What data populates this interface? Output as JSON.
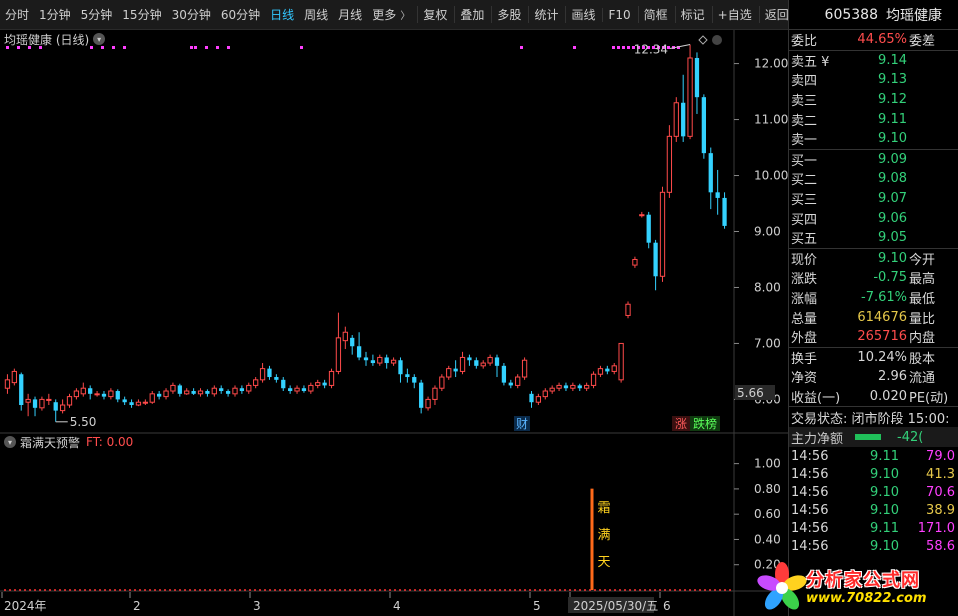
{
  "toolbar": {
    "items": [
      {
        "label": "分时",
        "active": false
      },
      {
        "label": "1分钟",
        "active": false
      },
      {
        "label": "5分钟",
        "active": false
      },
      {
        "label": "15分钟",
        "active": false
      },
      {
        "label": "30分钟",
        "active": false
      },
      {
        "label": "60分钟",
        "active": false
      },
      {
        "label": "日线",
        "active": true
      },
      {
        "label": "周线",
        "active": false
      },
      {
        "label": "月线",
        "active": false
      }
    ],
    "more": "更多",
    "right_items": [
      "复权",
      "叠加",
      "多股",
      "统计",
      "画线",
      "F10",
      "简框",
      "标记",
      "+自选",
      "返回"
    ]
  },
  "chart": {
    "title": "均瑶健康 (日线)",
    "high_label": "12.34",
    "low_label": "5.50",
    "price_tag": "5.66",
    "marker_cai": "财",
    "marker_zhang": "涨",
    "marker_die": "跌榜",
    "y_ticks": [
      "12.00",
      "11.00",
      "10.00",
      "9.00",
      "8.00",
      "7.00",
      "6.00"
    ],
    "date_labels": [
      "2024年",
      "2",
      "3",
      "4",
      "5",
      "2025/05/30/五",
      "6"
    ]
  },
  "indicator": {
    "name": "霜满天预警",
    "ft": "FT: 0.00",
    "signal_chars": [
      "霜",
      "满",
      "天"
    ],
    "y_ticks": [
      "1.00",
      "0.80",
      "0.60",
      "0.40",
      "0.20"
    ]
  },
  "chart_data": {
    "type": "candlestick",
    "title": "均瑶健康 (日线)",
    "ylim": [
      5.4,
      12.6
    ],
    "candles": [
      [
        6.2,
        6.35,
        6.45,
        6.1
      ],
      [
        6.3,
        6.5,
        6.55,
        6.25
      ],
      [
        6.45,
        5.9,
        6.48,
        5.8
      ],
      [
        5.95,
        6.0,
        6.1,
        5.7
      ],
      [
        6.0,
        5.85,
        6.05,
        5.7
      ],
      [
        5.85,
        6.0,
        6.05,
        5.8
      ],
      [
        6.0,
        6.0,
        6.1,
        5.9
      ],
      [
        5.95,
        5.8,
        6.0,
        5.6
      ],
      [
        5.8,
        5.9,
        6.0,
        5.75
      ],
      [
        5.9,
        6.05,
        6.1,
        5.85
      ],
      [
        6.05,
        6.15,
        6.2,
        6.0
      ],
      [
        6.1,
        6.2,
        6.3,
        6.05
      ],
      [
        6.2,
        6.1,
        6.25,
        6.0
      ],
      [
        6.1,
        6.1,
        6.15,
        6.05
      ],
      [
        6.1,
        6.05,
        6.15,
        6.0
      ],
      [
        6.05,
        6.15,
        6.2,
        6.0
      ],
      [
        6.15,
        6.0,
        6.18,
        5.95
      ],
      [
        6.0,
        5.95,
        6.05,
        5.9
      ],
      [
        5.95,
        5.9,
        6.0,
        5.85
      ],
      [
        5.9,
        5.95,
        6.0,
        5.88
      ],
      [
        5.95,
        5.95,
        6.0,
        5.9
      ],
      [
        5.95,
        6.1,
        6.15,
        5.92
      ],
      [
        6.1,
        6.05,
        6.15,
        6.0
      ],
      [
        6.05,
        6.15,
        6.2,
        6.0
      ],
      [
        6.15,
        6.25,
        6.3,
        6.1
      ],
      [
        6.25,
        6.1,
        6.28,
        6.05
      ],
      [
        6.1,
        6.15,
        6.2,
        6.08
      ],
      [
        6.15,
        6.1,
        6.2,
        6.08
      ],
      [
        6.1,
        6.15,
        6.2,
        6.05
      ],
      [
        6.15,
        6.1,
        6.18,
        6.05
      ],
      [
        6.1,
        6.2,
        6.25,
        6.05
      ],
      [
        6.2,
        6.15,
        6.25,
        6.1
      ],
      [
        6.15,
        6.1,
        6.18,
        6.05
      ],
      [
        6.1,
        6.2,
        6.25,
        6.05
      ],
      [
        6.2,
        6.15,
        6.25,
        6.1
      ],
      [
        6.15,
        6.25,
        6.3,
        6.1
      ],
      [
        6.25,
        6.35,
        6.4,
        6.2
      ],
      [
        6.35,
        6.55,
        6.65,
        6.3
      ],
      [
        6.55,
        6.4,
        6.6,
        6.35
      ],
      [
        6.4,
        6.35,
        6.45,
        6.3
      ],
      [
        6.35,
        6.2,
        6.4,
        6.15
      ],
      [
        6.2,
        6.15,
        6.25,
        6.1
      ],
      [
        6.15,
        6.2,
        6.25,
        6.1
      ],
      [
        6.2,
        6.15,
        6.25,
        6.12
      ],
      [
        6.15,
        6.25,
        6.3,
        6.1
      ],
      [
        6.25,
        6.3,
        6.35,
        6.2
      ],
      [
        6.3,
        6.25,
        6.35,
        6.2
      ],
      [
        6.25,
        6.5,
        6.55,
        6.2
      ],
      [
        6.5,
        7.1,
        7.55,
        6.45
      ],
      [
        7.05,
        7.2,
        7.3,
        6.9
      ],
      [
        7.1,
        6.95,
        7.15,
        6.8
      ],
      [
        6.95,
        6.75,
        7.2,
        6.7
      ],
      [
        6.75,
        6.7,
        6.85,
        6.6
      ],
      [
        6.7,
        6.65,
        6.8,
        6.6
      ],
      [
        6.65,
        6.75,
        6.8,
        6.6
      ],
      [
        6.75,
        6.65,
        6.8,
        6.55
      ],
      [
        6.65,
        6.7,
        6.75,
        6.6
      ],
      [
        6.7,
        6.45,
        6.75,
        6.3
      ],
      [
        6.45,
        6.4,
        6.55,
        6.3
      ],
      [
        6.4,
        6.3,
        6.45,
        6.2
      ],
      [
        6.3,
        5.85,
        6.35,
        5.75
      ],
      [
        5.85,
        6.0,
        6.05,
        5.8
      ],
      [
        6.0,
        6.2,
        6.25,
        5.9
      ],
      [
        6.2,
        6.4,
        6.45,
        6.15
      ],
      [
        6.4,
        6.55,
        6.6,
        6.35
      ],
      [
        6.55,
        6.5,
        6.7,
        6.4
      ],
      [
        6.5,
        6.75,
        6.85,
        6.45
      ],
      [
        6.75,
        6.7,
        6.8,
        6.6
      ],
      [
        6.7,
        6.6,
        6.75,
        6.55
      ],
      [
        6.6,
        6.65,
        6.7,
        6.55
      ],
      [
        6.65,
        6.75,
        6.8,
        6.6
      ],
      [
        6.75,
        6.6,
        6.8,
        6.4
      ],
      [
        6.6,
        6.3,
        6.65,
        6.25
      ],
      [
        6.3,
        6.25,
        6.35,
        6.2
      ],
      [
        6.25,
        6.4,
        6.45,
        6.2
      ],
      [
        6.4,
        6.7,
        6.75,
        6.35
      ],
      [
        6.1,
        5.95,
        6.15,
        5.85
      ],
      [
        5.95,
        6.05,
        6.1,
        5.9
      ],
      [
        6.05,
        6.15,
        6.2,
        6.0
      ],
      [
        6.15,
        6.2,
        6.25,
        6.1
      ],
      [
        6.2,
        6.25,
        6.3,
        6.15
      ],
      [
        6.25,
        6.2,
        6.3,
        6.15
      ],
      [
        6.2,
        6.25,
        6.3,
        6.15
      ],
      [
        6.25,
        6.2,
        6.28,
        6.15
      ],
      [
        6.2,
        6.25,
        6.3,
        6.15
      ],
      [
        6.25,
        6.45,
        6.5,
        6.2
      ],
      [
        6.45,
        6.55,
        6.6,
        6.4
      ],
      [
        6.55,
        6.5,
        6.6,
        6.45
      ],
      [
        6.5,
        6.6,
        6.65,
        6.45
      ],
      [
        6.35,
        7.0,
        7.0,
        6.3
      ],
      [
        7.5,
        7.7,
        7.75,
        7.45
      ],
      [
        8.4,
        8.5,
        8.55,
        8.35
      ],
      [
        9.3,
        9.3,
        9.35,
        9.25
      ],
      [
        9.3,
        8.8,
        9.35,
        8.7
      ],
      [
        8.8,
        8.2,
        8.85,
        7.95
      ],
      [
        8.2,
        9.7,
        9.8,
        8.1
      ],
      [
        9.7,
        10.7,
        10.9,
        9.6
      ],
      [
        10.7,
        11.3,
        11.4,
        10.6
      ],
      [
        11.3,
        10.7,
        11.8,
        10.6
      ],
      [
        10.7,
        12.1,
        12.34,
        10.65
      ],
      [
        12.1,
        11.4,
        12.2,
        11.1
      ],
      [
        11.4,
        10.4,
        11.45,
        10.3
      ],
      [
        10.4,
        9.7,
        10.5,
        9.4
      ],
      [
        9.7,
        9.6,
        10.1,
        9.3
      ],
      [
        9.6,
        9.1,
        9.7,
        9.05
      ]
    ],
    "indicator": {
      "name": "霜满天预警",
      "ylim": [
        0,
        1.1
      ],
      "signals": [
        {
          "date": "2025/05/30/五",
          "value": 1.0
        }
      ]
    }
  },
  "panel": {
    "code": "605388",
    "name": "均瑶健康",
    "weibi": {
      "label": "委比",
      "value": "44.65%",
      "label2": "委差"
    },
    "asks": [
      {
        "label": "卖五 ¥",
        "price": "9.14"
      },
      {
        "label": "卖四",
        "price": "9.13"
      },
      {
        "label": "卖三",
        "price": "9.12"
      },
      {
        "label": "卖二",
        "price": "9.11"
      },
      {
        "label": "卖一",
        "price": "9.10"
      }
    ],
    "bids": [
      {
        "label": "买一",
        "price": "9.09"
      },
      {
        "label": "买二",
        "price": "9.08"
      },
      {
        "label": "买三",
        "price": "9.07"
      },
      {
        "label": "买四",
        "price": "9.06"
      },
      {
        "label": "买五",
        "price": "9.05"
      }
    ],
    "quote": [
      {
        "label": "现价",
        "value": "9.10",
        "color": "g",
        "label2": "今开"
      },
      {
        "label": "涨跌",
        "value": "-0.75",
        "color": "g",
        "label2": "最高"
      },
      {
        "label": "涨幅",
        "value": "-7.61%",
        "color": "g",
        "label2": "最低"
      },
      {
        "label": "总量",
        "value": "614676",
        "color": "y",
        "label2": "量比"
      },
      {
        "label": "外盘",
        "value": "265716",
        "color": "r",
        "label2": "内盘"
      }
    ],
    "quote2": [
      {
        "label": "换手",
        "value": "10.24%",
        "color": "w",
        "label2": "股本"
      },
      {
        "label": "净资",
        "value": "2.96",
        "color": "w",
        "label2": "流通"
      },
      {
        "label": "收益(一)",
        "value": "0.020",
        "color": "w",
        "label2": "PE(动)"
      }
    ],
    "state": "交易状态: 闭市阶段 15:00:",
    "net_label": "主力净额",
    "net_value": "-42(",
    "ticks": [
      {
        "time": "14:56",
        "price": "9.11",
        "vol": "79.0",
        "color": "m"
      },
      {
        "time": "14:56",
        "price": "9.10",
        "vol": "41.3",
        "color": "y"
      },
      {
        "time": "14:56",
        "price": "9.10",
        "vol": "70.6",
        "color": "m"
      },
      {
        "time": "14:56",
        "price": "9.10",
        "vol": "38.9",
        "color": "y"
      },
      {
        "time": "14:56",
        "price": "9.11",
        "vol": "171.0",
        "color": "m"
      },
      {
        "time": "14:56",
        "price": "9.10",
        "vol": "58.6",
        "color": "m"
      }
    ]
  },
  "watermark": {
    "text": "分析家公式网",
    "url": "www.70822.com"
  }
}
